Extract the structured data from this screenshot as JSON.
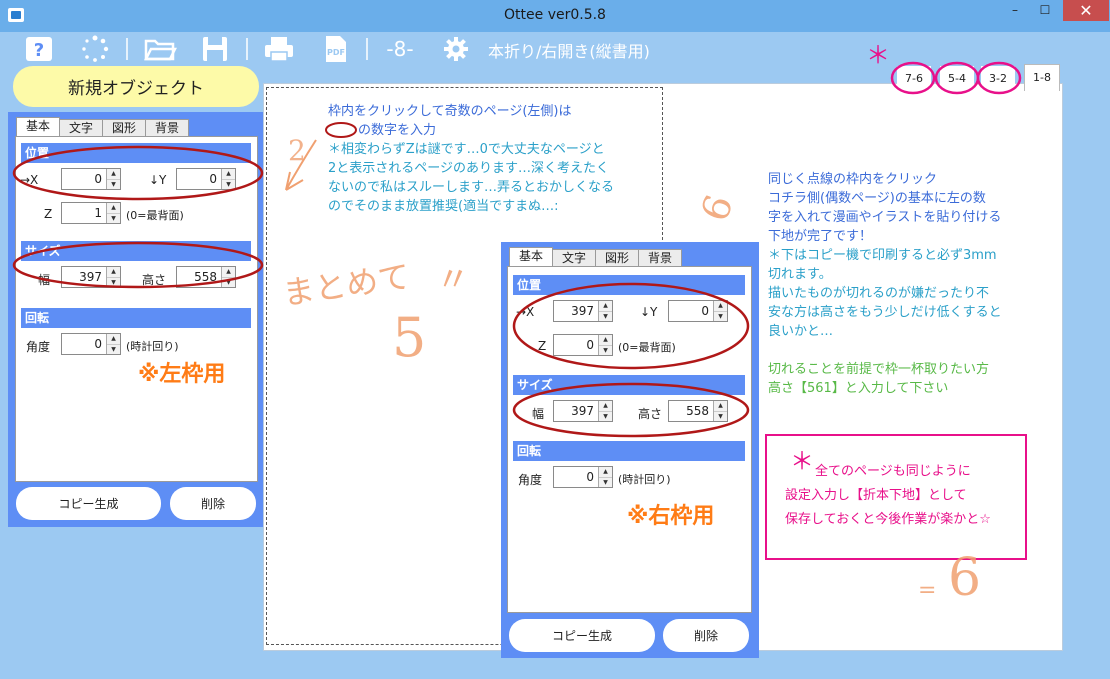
{
  "window": {
    "title": "Ottee ver0.5.8",
    "min": "–",
    "max": "☐",
    "close": "✕"
  },
  "toolbar": {
    "page_count_label": "-8-",
    "mode_label": "本折り/右開き(縦書用)"
  },
  "left_panel": {
    "new_object_label": "新規オブジェクト",
    "tabs": [
      "基本",
      "文字",
      "図形",
      "背景"
    ],
    "position": {
      "title": "位置",
      "x_label": "→X",
      "x_value": "0",
      "y_label": "↓Y",
      "y_value": "0",
      "z_label": "Z",
      "z_value": "1",
      "z_note": "(0=最背面)"
    },
    "size": {
      "title": "サイズ",
      "width_label": "幅",
      "width_value": "397",
      "height_label": "高さ",
      "height_value": "558"
    },
    "rotation": {
      "title": "回転",
      "angle_label": "角度",
      "angle_value": "0",
      "angle_note": "(時計回り)"
    },
    "copy_label": "コピー生成",
    "delete_label": "削除"
  },
  "right_panel": {
    "tabs": [
      "基本",
      "文字",
      "図形",
      "背景"
    ],
    "position": {
      "title": "位置",
      "x_label": "→X",
      "x_value": "397",
      "y_label": "↓Y",
      "y_value": "0",
      "z_label": "Z",
      "z_value": "0",
      "z_note": "(0=最背面)"
    },
    "size": {
      "title": "サイズ",
      "width_label": "幅",
      "width_value": "397",
      "height_label": "高さ",
      "height_value": "558"
    },
    "rotation": {
      "title": "回転",
      "angle_label": "角度",
      "angle_value": "0",
      "angle_note": "(時計回り)"
    },
    "copy_label": "コピー生成",
    "delete_label": "削除"
  },
  "page_tabs": [
    "7-6",
    "5-4",
    "3-2",
    "1-8"
  ],
  "annotations": {
    "left_frame_label": "※左枠用",
    "right_frame_label": "※右枠用",
    "note_left_1": "枠内をクリックして奇数のページ(左側)は",
    "note_left_2": "の数字を入力",
    "note_left_3": "＊相変わらずZは謎です…0で大丈夫なページと",
    "note_left_4": "2と表示されるページのあります…深く考えたく",
    "note_left_5": "ないので私はスルーします…弄るとおかしくなる",
    "note_left_6": "のでそのまま放置推奨(適当ですまぬ…:",
    "note_right": [
      "同じく点線の枠内をクリック",
      "コチラ側(偶数ページ)の基本に左の数",
      "字を入れて漫画やイラストを貼り付ける",
      "下地が完了です！",
      "＊下はコピー機で印刷すると必ず3mm",
      "切れます。",
      "描いたものが切れるのが嫌だったり不",
      "安な方は高さをもう少しだけ低くすると",
      "良いかと…"
    ],
    "note_green": [
      "切れることを前提で枠一杯取りたい方",
      "高さ【561】と入力して下さい"
    ],
    "pink_box": [
      "全てのページも同じように",
      "設定入力し【折本下地】として",
      "保存しておくと今後作業が楽かと☆"
    ],
    "asterisk": "＊",
    "hand_matome": "まとめて",
    "hand_five": "5",
    "hand_quote": "〃",
    "hand_six": "6",
    "hand_six_b": "6",
    "hand_two": "2",
    "hand_eq": "=",
    "colors": {
      "red_circle": "#b01818",
      "pink": "#e8108a",
      "orange": "#ff7c16",
      "blue_text": "#3b6bd8",
      "teal_text": "#2ba0c9",
      "green_text": "#58b947",
      "panel_blue": "#5e8ef5"
    }
  }
}
